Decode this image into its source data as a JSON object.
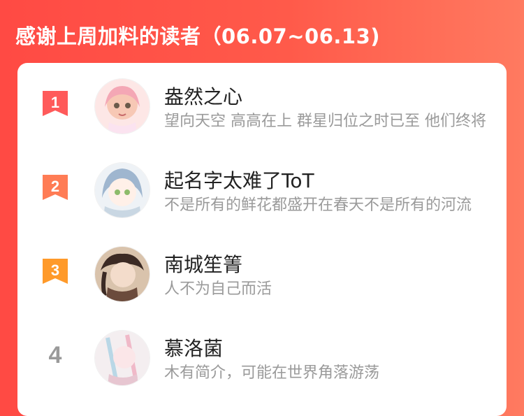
{
  "header": {
    "title": "感谢上周加料的读者（06.07~06.13)"
  },
  "rows": [
    {
      "rank": "1",
      "name": "盎然之心",
      "bio": "望向天空 高高在上 群星归位之时已至 他们终将回归",
      "rank_color": "#ff5a5a"
    },
    {
      "rank": "2",
      "name": "起名字太难了ToT",
      "bio": "不是所有的鲜花都盛开在春天不是所有的河流",
      "rank_color": "#ff7c55"
    },
    {
      "rank": "3",
      "name": "南城笙箐",
      "bio": "人不为自己而活",
      "rank_color": "#ff9a2a"
    },
    {
      "rank": "4",
      "name": "慕洛菌",
      "bio": "木有简介，可能在世界角落游荡"
    }
  ],
  "colors": {
    "bg_start": "#ff4a44",
    "bg_end": "#ff7a60"
  },
  "icons": {
    "rank_badge": "ribbon-badge-icon"
  }
}
